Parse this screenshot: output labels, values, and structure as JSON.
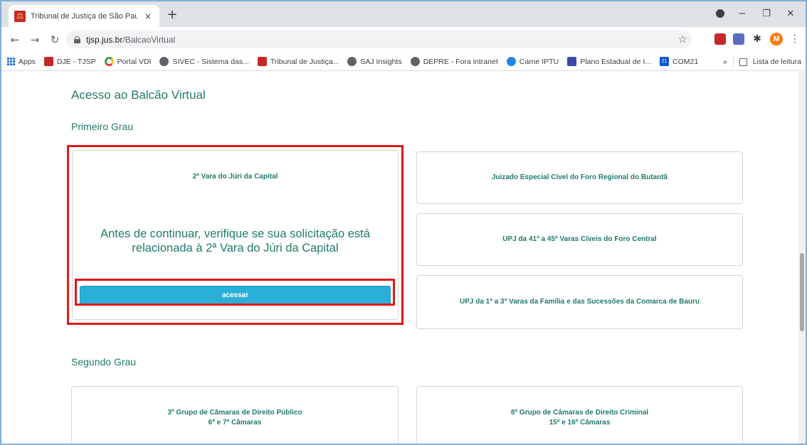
{
  "browser": {
    "tab_title": "Tribunal de Justiça de São Paulo",
    "tab_close": "×",
    "new_tab": "+",
    "url_host": "tjsp.jus.br",
    "url_path": "/BalcaoVirtual",
    "avatar_letter": "M",
    "window_controls": {
      "minimize": "−",
      "maximize": "❐",
      "close": "✕"
    }
  },
  "bookmarks": {
    "items": [
      {
        "label": "Apps",
        "icon": "apps-grid-icon"
      },
      {
        "label": "DJE - TJSP",
        "icon": "tjsp-icon"
      },
      {
        "label": "Portal VDI",
        "icon": "vdi-icon"
      },
      {
        "label": "SIVEC - Sistema das...",
        "icon": "globe-icon"
      },
      {
        "label": "Tribunal de Justiça...",
        "icon": "tjsp-icon"
      },
      {
        "label": "SAJ Insights",
        "icon": "globe-icon"
      },
      {
        "label": "DEPRE - Fora intranet",
        "icon": "globe-icon"
      },
      {
        "label": "Carne IPTU",
        "icon": "globe-blue-icon"
      },
      {
        "label": "Plano Estadual de I...",
        "icon": "doc-icon"
      },
      {
        "label": "COM21",
        "icon": "calendar-icon"
      }
    ],
    "overflow": "»",
    "reading_list": "Lista de leitura"
  },
  "page": {
    "title": "Acesso ao Balcão Virtual",
    "primeiro_grau": "Primeiro Grau",
    "segundo_grau": "Segundo Grau",
    "selected_card": {
      "title": "2ª Vara do Júri da Capital",
      "warning": "Antes de continuar, verifique se sua solicitação está relacionada à 2ª Vara do Júri da Capital",
      "button": "acessar"
    },
    "cards": {
      "butanta": "Juizado Especial Cível do Foro Regional do Butantã",
      "upj41": "UPJ da 41ª a 45ª Varas Cíveis do Foro Central",
      "upj1": "UPJ da 1ª a 3ª Varas da Família e das Sucessões da Comarca de Bauru",
      "grupo3_line1": "3º Grupo de Câmaras de Direito Público",
      "grupo3_line2": "6ª e 7ª Câmaras",
      "grupo8_line1": "8º Grupo de Câmaras de Direito Criminal",
      "grupo8_line2": "15ª e 16ª Câmaras"
    }
  },
  "colors": {
    "accent_green": "#217a6b",
    "button_blue": "#2ab0d8",
    "highlight_red": "#e01818"
  }
}
